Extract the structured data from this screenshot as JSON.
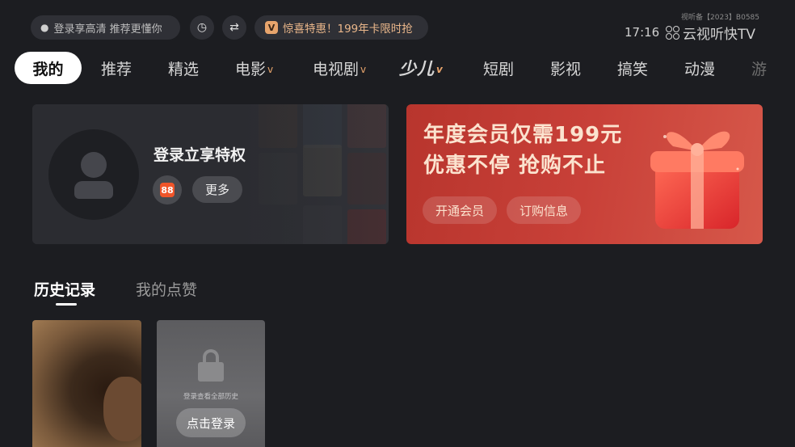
{
  "topbar": {
    "login_prompt": "登录享高清 推荐更懂你",
    "promo_badge": "V",
    "promo_text": "惊喜特惠！199年卡限时抢",
    "license": "视听备【2023】B0585",
    "time": "17:16",
    "brand": "云视听快TV"
  },
  "nav": {
    "items": [
      {
        "label": "我的"
      },
      {
        "label": "推荐"
      },
      {
        "label": "精选"
      },
      {
        "label": "电影",
        "chevron": "v"
      },
      {
        "label": "电视剧",
        "chevron": "v"
      },
      {
        "label": "少儿",
        "chevron": "v"
      },
      {
        "label": "短剧"
      },
      {
        "label": "影视"
      },
      {
        "label": "搞笑"
      },
      {
        "label": "动漫"
      },
      {
        "label": "游"
      }
    ]
  },
  "login_card": {
    "title": "登录立享特权",
    "app_icon_text": "88",
    "more_label": "更多"
  },
  "vip_card": {
    "line1": "年度会员仅需199元",
    "line2": "优惠不停 抢购不止",
    "open_label": "开通会员",
    "order_label": "订购信息"
  },
  "history": {
    "tab_history": "历史记录",
    "tab_likes": "我的点赞",
    "locked_hint": "登录查看全部历史",
    "login_button": "点击登录"
  },
  "colors": {
    "background": "#1c1d21",
    "accent": "#e7a46c",
    "vip_red": "#c84038"
  }
}
